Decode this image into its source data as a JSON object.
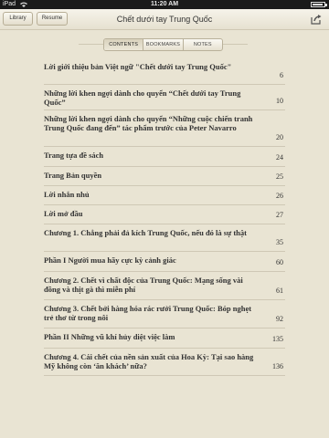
{
  "status_bar": {
    "carrier": "iPad",
    "time": "11:20 AM"
  },
  "toolbar": {
    "library_label": "Library",
    "resume_label": "Resume",
    "book_title": "Chết dưới tay Trung Quốc",
    "share_icon": "share-icon"
  },
  "tabs": [
    {
      "label": "CONTENTS",
      "active": true
    },
    {
      "label": "BOOKMARKS",
      "active": false
    },
    {
      "label": "NOTES",
      "active": false
    }
  ],
  "toc": [
    {
      "title": "Lời giới thiệu bản Việt ngữ \"Chết dưới tay Trung Quốc\"",
      "page": "6"
    },
    {
      "title": "Những lời khen ngợi dành cho quyển “Chết dưới tay Trung Quốc”",
      "page": "10"
    },
    {
      "title": "Những lời khen ngợi dành cho quyển “Những cuộc chiến tranh Trung Quốc đang đến” tác phẩm trước của Peter Navarro",
      "page": "20"
    },
    {
      "title": "Trang tựa đề sách",
      "page": "24"
    },
    {
      "title": "Trang Bản quyền",
      "page": "25"
    },
    {
      "title": "Lời nhắn nhủ",
      "page": "26"
    },
    {
      "title": "Lời mở đầu",
      "page": "27"
    },
    {
      "title": "Chương 1. Chẳng phải đả kích Trung Quốc, nếu đó là sự thật",
      "page": "35"
    },
    {
      "title": "Phần I  Người mua hãy cực kỳ cảnh giác",
      "page": "60"
    },
    {
      "title": "Chương 2. Chết vì chất độc của Trung Quốc: Mạng sống vài đồng và thịt gà thì miễn phí",
      "page": "61"
    },
    {
      "title": "Chương 3. Chết bởi hàng hóa rác rưởi Trung Quốc: Bóp nghẹt trẻ thơ từ trong nôi",
      "page": "92"
    },
    {
      "title": "Phần II  Những vũ khí hủy diệt việc làm",
      "page": "135"
    },
    {
      "title": "Chương 4. Cái chết của nền sản xuất của Hoa Kỳ: Tại sao hàng Mỹ không còn ‘ăn khách’ nữa?",
      "page": "136"
    }
  ]
}
